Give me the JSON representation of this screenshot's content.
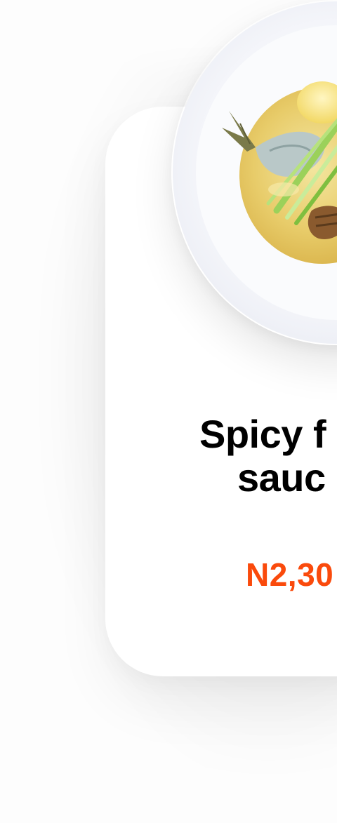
{
  "product": {
    "image_icon": "fish-dish-plate-image",
    "name_line1": "Spicy f",
    "name_line2": "sauc",
    "price": "N2,30"
  },
  "colors": {
    "accent": "#fa4a0c",
    "card": "#ffffff",
    "text": "#000000"
  }
}
